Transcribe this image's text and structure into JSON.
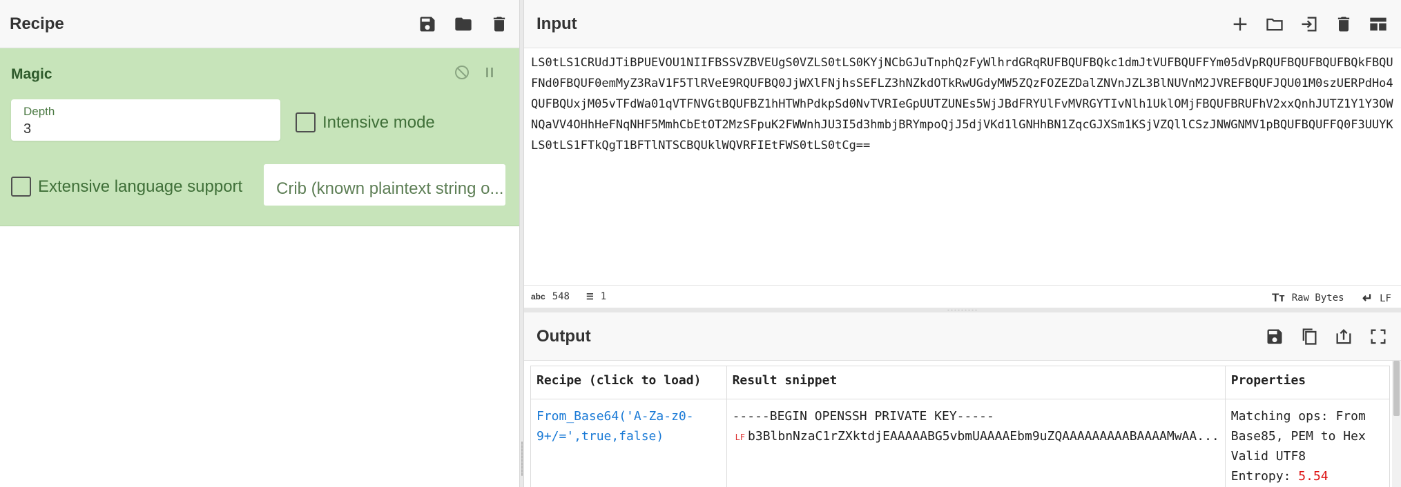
{
  "recipe": {
    "title": "Recipe",
    "operation": {
      "name": "Magic",
      "depth_label": "Depth",
      "depth_value": "3",
      "intensive_mode_label": "Intensive mode",
      "extensive_language_label": "Extensive language support",
      "crib_placeholder": "Crib (known plaintext string o..."
    }
  },
  "input": {
    "title": "Input",
    "text": "LS0tLS1CRUdJTiBPUEVOU1NIIFBSSVZBVEUgS0VZLS0tLS0KYjNCbGJuTnphQzFyWlhrdGRqRUFBQUFBQkc1dmJtVUFBQUFFYm05dVpRQUFBQUFBQUFBQkFBQUFNd0FBQUF0emMyZ3RaV1F5TlRVeE9RQUFBQ0JjWXlFNjhsSEFLZ3hNZkdOTkRwUGdyMW5ZQzFOZEZDalZNVnJZL3BlNUVnM2JVREFBQUFJQU01M0szUERPdHo4QUFBQUxjM05vTFdWa01qVTFNVGtBQUFBZ1hHTWhPdkpSd0NvTVRIeGpUUTZUNEs5WjJBdFRYUlFvMVRGYTIvNlh1UklOMjFBQUFBRUFhV2xxQnhJUTZ1Y1Y3OWNQaVV4OHhHeFNqNHF5MmhCbEtOT2MzSFpuK2FWWnhJU3I5d3hmbjBRYmpoQjJ5djVKd1lGNHhBN1ZqcGJXSm1KSjVZQllCSzJNWGNMV1pBQUFBQUFFQ0F3UUYKLS0tLS1FTkQgT1BFTlNTSCBQUklWQVRFIEtFWS0tLS0tCg==",
    "status": {
      "chars_icon": "abc",
      "chars": "548",
      "lines": "1",
      "format": "Raw Bytes",
      "eol": "LF"
    }
  },
  "output": {
    "title": "Output",
    "table": {
      "headers": [
        "Recipe (click to load)",
        "Result snippet",
        "Properties"
      ],
      "row": {
        "recipe": "From_Base64('A-Za-z0-9+/=',true,false)",
        "snippet_line1": "-----BEGIN OPENSSH PRIVATE KEY-----",
        "snippet_lf": "LF",
        "snippet_rest": "b3BlbnNzaC1rZXktdjEAAAAABG5vbmUAAAAEbm9uZQAAAAAAAAABAAAAMwAA...",
        "matching_ops": "Matching ops: From Base85, PEM to Hex",
        "valid": "Valid UTF8",
        "entropy_label": "Entropy:",
        "entropy_value": "5.54"
      }
    }
  },
  "colors": {
    "operation_bg": "#c7e4ba",
    "link": "#1a7ad6",
    "entropy": "#d11111"
  }
}
